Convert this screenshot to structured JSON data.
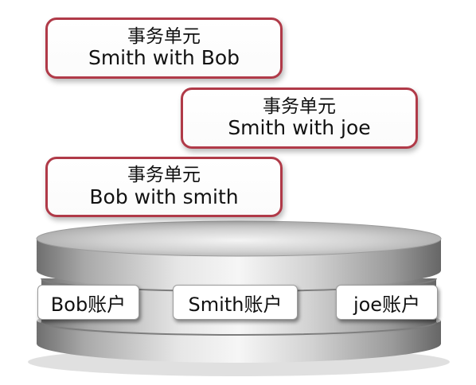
{
  "transactions": [
    {
      "title": "事务单元",
      "desc": "Smith with Bob"
    },
    {
      "title": "事务单元",
      "desc": "Smith with joe"
    },
    {
      "title": "事务单元",
      "desc": "Bob with smith"
    }
  ],
  "accounts": [
    {
      "label": "Bob账户"
    },
    {
      "label": "Smith账户"
    },
    {
      "label": "joe账户"
    }
  ],
  "colors": {
    "box_border": "#b03a48",
    "disk_metal": "#b8b8b8"
  }
}
